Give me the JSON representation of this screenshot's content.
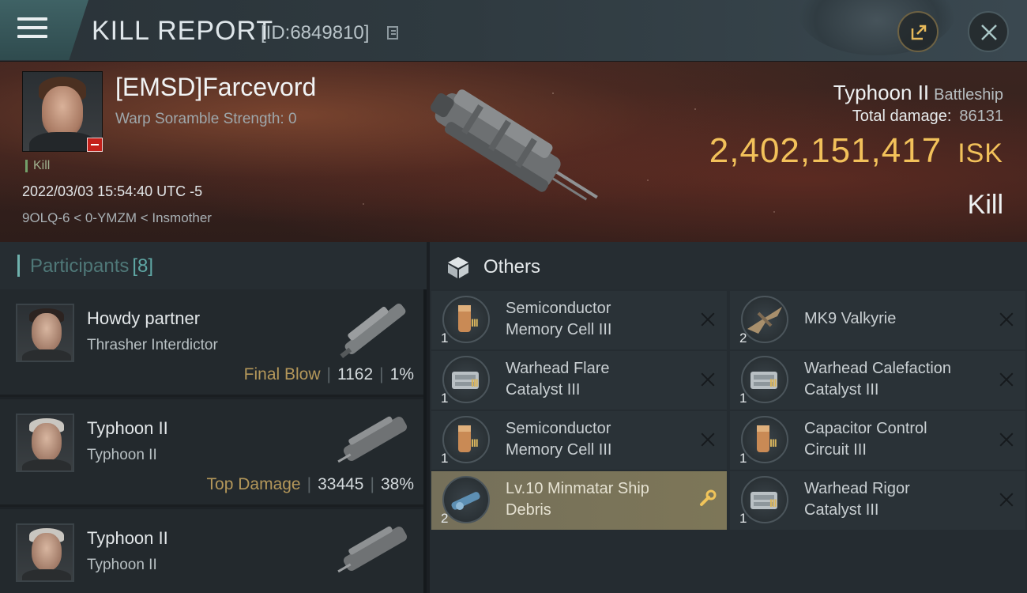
{
  "header": {
    "title": "KILL REPORT",
    "report_id": "[ID:6849810]",
    "icons": {
      "menu": "hamburger-menu-icon",
      "copy": "copy-icon",
      "share": "share-icon",
      "close": "close-icon"
    }
  },
  "victim": {
    "name": "[EMSD]Farcevord",
    "warp_scramble": "Warp Soramble Strength: 0",
    "kill_tag": "Kill",
    "timestamp": "2022/03/03 15:54:40 UTC -5",
    "location": "9OLQ-6 < 0-YMZM < Insmother",
    "ship_name": "Typhoon II",
    "ship_class": "Battleship",
    "total_damage_label": "Total damage:",
    "total_damage": "86131",
    "isk_value": "2,402,151,417",
    "isk_unit": "ISK",
    "result": "Kill"
  },
  "participants": {
    "label": "Participants",
    "count": "[8]",
    "items": [
      {
        "name": "Howdy partner",
        "ship": "Thrasher Interdictor",
        "tag": "Final Blow",
        "damage": "1162",
        "percent": "1%"
      },
      {
        "name": "Typhoon II",
        "ship": "Typhoon II",
        "tag": "Top Damage",
        "damage": "33445",
        "percent": "38%"
      },
      {
        "name": "Typhoon II",
        "ship": "Typhoon II",
        "tag": "",
        "damage": "",
        "percent": ""
      }
    ]
  },
  "others": {
    "title": "Others",
    "items": [
      {
        "line1": "Semiconductor",
        "line2": "Memory Cell III",
        "qty": "1",
        "tier": "III",
        "icon": "memory-cell-icon"
      },
      {
        "line1": "MK9  Valkyrie",
        "line2": "",
        "qty": "2",
        "tier": "",
        "icon": "drone-icon"
      },
      {
        "line1": "Warhead Flare",
        "line2": "Catalyst III",
        "qty": "1",
        "tier": "III",
        "icon": "warhead-rig-icon"
      },
      {
        "line1": "Warhead Calefaction",
        "line2": "Catalyst III",
        "qty": "1",
        "tier": "III",
        "icon": "warhead-rig-icon"
      },
      {
        "line1": "Semiconductor",
        "line2": "Memory Cell III",
        "qty": "1",
        "tier": "III",
        "icon": "memory-cell-icon"
      },
      {
        "line1": "Capacitor Control",
        "line2": "Circuit III",
        "qty": "1",
        "tier": "III",
        "icon": "capacitor-rig-icon"
      },
      {
        "line1": "Lv.10 Minmatar Ship",
        "line2": "Debris",
        "qty": "2",
        "tier": "",
        "icon": "ship-debris-icon"
      },
      {
        "line1": "Warhead Rigor",
        "line2": "Catalyst III",
        "qty": "1",
        "tier": "III",
        "icon": "warhead-rig-icon"
      }
    ]
  },
  "colors": {
    "isk": "#f2c15a",
    "accent_teal": "#6fb2ae",
    "tag_gold": "#b4975a",
    "highlight": "#75705a"
  }
}
